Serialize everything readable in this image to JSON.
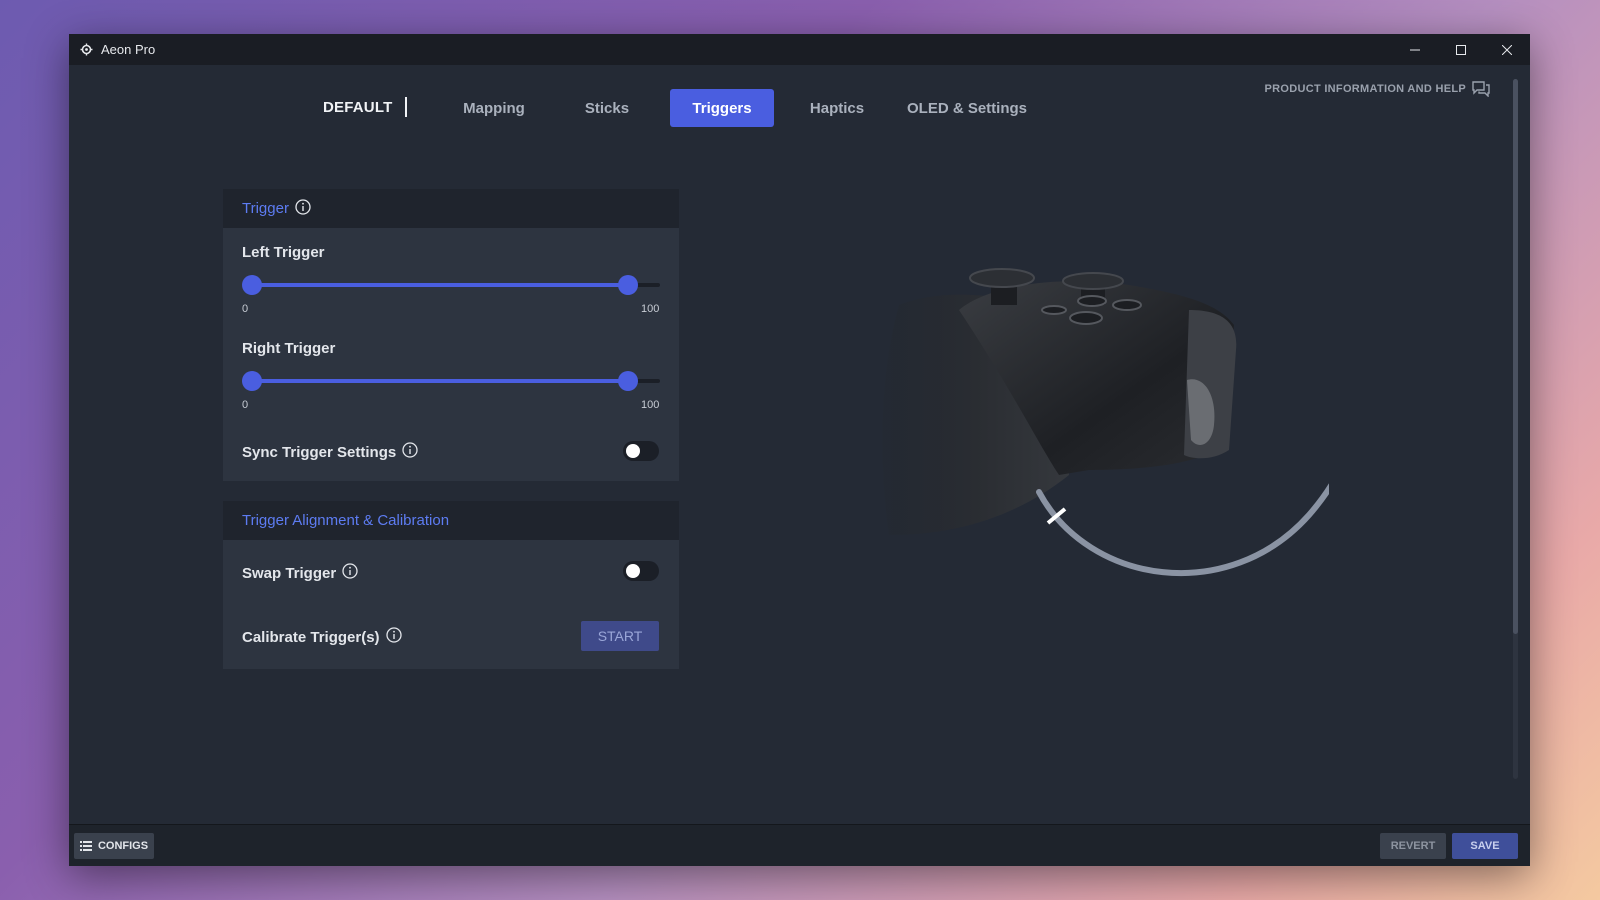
{
  "window": {
    "title": "Aeon Pro"
  },
  "header": {
    "profile_name": "DEFAULT",
    "tabs": [
      {
        "label": "Mapping",
        "active": false
      },
      {
        "label": "Sticks",
        "active": false
      },
      {
        "label": "Triggers",
        "active": true
      },
      {
        "label": "Haptics",
        "active": false
      },
      {
        "label": "OLED & Settings",
        "active": false
      }
    ],
    "help_link": "PRODUCT INFORMATION AND HELP"
  },
  "trigger_panel": {
    "title": "Trigger",
    "left_trigger": {
      "label": "Left Trigger",
      "min_value": 0,
      "max_value": 100,
      "min_label": "0",
      "max_label": "100"
    },
    "right_trigger": {
      "label": "Right Trigger",
      "min_value": 0,
      "max_value": 100,
      "min_label": "0",
      "max_label": "100"
    },
    "sync": {
      "label": "Sync Trigger Settings",
      "enabled": false
    }
  },
  "calibration_panel": {
    "title": "Trigger Alignment & Calibration",
    "swap": {
      "label": "Swap Trigger",
      "enabled": false
    },
    "calibrate": {
      "label": "Calibrate Trigger(s)",
      "button": "START"
    }
  },
  "footer": {
    "configs_label": "CONFIGS",
    "revert_label": "REVERT",
    "save_label": "SAVE"
  },
  "colors": {
    "accent": "#4a5ee0",
    "panel_title": "#5d7cf2",
    "background": "#242a35"
  }
}
